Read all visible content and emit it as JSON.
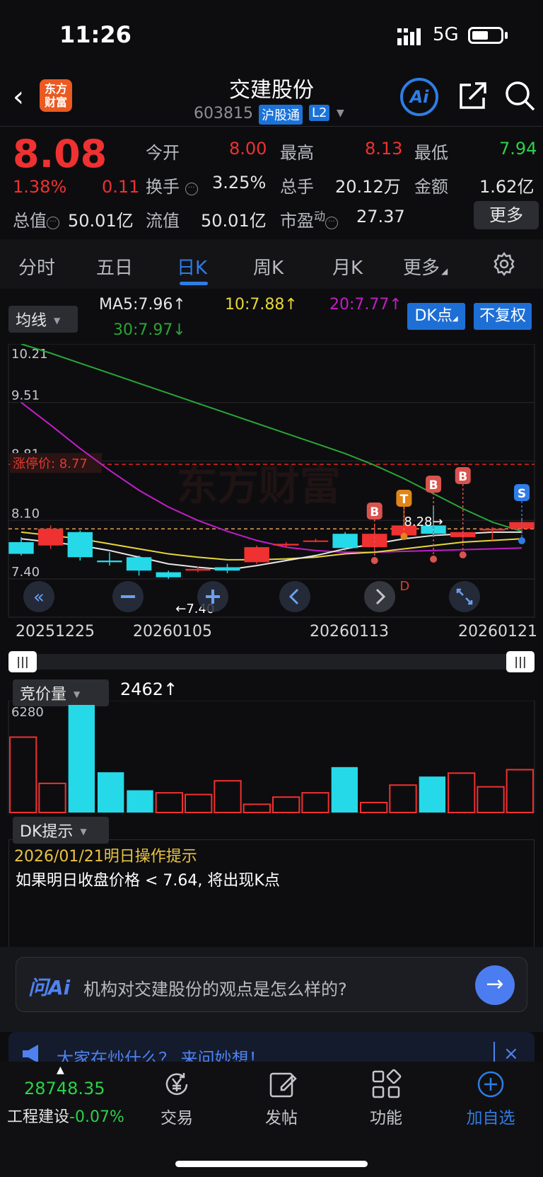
{
  "status": {
    "time": "11:26",
    "network": "5G"
  },
  "header": {
    "logo_line1": "东方",
    "logo_line2": "财富",
    "name": "交建股份",
    "code": "603815",
    "badge_hgt": "沪股通",
    "badge_l2": "L2",
    "ai_label": "Ai"
  },
  "quote": {
    "price": "8.08",
    "change_pct": "1.38%",
    "change_abs": "0.11",
    "open_label": "今开",
    "open": "8.00",
    "high_label": "最高",
    "high": "8.13",
    "low_label": "最低",
    "low": "7.94",
    "turnover_label": "换手",
    "turnover": "3.25%",
    "volume_label": "总手",
    "volume": "20.12万",
    "amount_label": "金额",
    "amount": "1.62亿",
    "mktcap_label": "总值",
    "mktcap": "50.01亿",
    "float_label": "流值",
    "float": "50.01亿",
    "pe_label": "市盈",
    "pe_sup": "动",
    "pe": "27.37",
    "more": "更多"
  },
  "tabs": [
    "分时",
    "五日",
    "日K",
    "周K",
    "月K",
    "更多"
  ],
  "active_tab": "日K",
  "indicator_bar": {
    "dropdown": "均线",
    "ma5": "MA5:7.96↑",
    "ma10": "10:7.88↑",
    "ma20": "20:7.77↑",
    "ma30": "30:7.97↓",
    "dk_button": "DK点",
    "fq_button": "不复权"
  },
  "colors": {
    "up": "#ef3131",
    "down": "#25d9e8",
    "ma5": "#e6e6e6",
    "ma10": "#e8d63a",
    "ma20": "#c21ec8",
    "ma30": "#2aa537",
    "accent": "#2f7de6"
  },
  "chart_data": {
    "type": "candlestick",
    "y_ticks": [
      "10.21",
      "9.51",
      "8.81",
      "8.10",
      "7.40"
    ],
    "ylim": [
      7.4,
      10.21
    ],
    "limit_up_label": "涨停价: 8.77",
    "limit_up": 8.77,
    "ref_line": 8.1,
    "watermark": "东方财富",
    "low_annotation": "←7.40",
    "high_annotation": "8.28→",
    "signals": [
      "B",
      "T",
      "B",
      "B",
      "S",
      "D"
    ],
    "x_labels": [
      "20251225",
      "20260105",
      "20260113",
      "20260121"
    ],
    "candles": [
      {
        "o": 7.84,
        "c": 7.7,
        "h": 7.9,
        "l": 7.68
      },
      {
        "o": 7.8,
        "c": 8.0,
        "h": 8.04,
        "l": 7.76
      },
      {
        "o": 7.96,
        "c": 7.66,
        "h": 7.98,
        "l": 7.62
      },
      {
        "o": 7.62,
        "c": 7.6,
        "h": 7.72,
        "l": 7.56
      },
      {
        "o": 7.66,
        "c": 7.5,
        "h": 7.68,
        "l": 7.44
      },
      {
        "o": 7.48,
        "c": 7.42,
        "h": 7.5,
        "l": 7.4
      },
      {
        "o": 7.5,
        "c": 7.52,
        "h": 7.55,
        "l": 7.48
      },
      {
        "o": 7.54,
        "c": 7.5,
        "h": 7.58,
        "l": 7.47
      },
      {
        "o": 7.6,
        "c": 7.78,
        "h": 7.8,
        "l": 7.58
      },
      {
        "o": 7.8,
        "c": 7.82,
        "h": 7.84,
        "l": 7.78
      },
      {
        "o": 7.86,
        "c": 7.86,
        "h": 7.88,
        "l": 7.84
      },
      {
        "o": 7.94,
        "c": 7.77,
        "h": 7.96,
        "l": 7.74
      },
      {
        "o": 7.78,
        "c": 7.94,
        "h": 8.04,
        "l": 7.76
      },
      {
        "o": 7.92,
        "c": 8.04,
        "h": 8.28,
        "l": 7.92
      },
      {
        "o": 8.04,
        "c": 7.94,
        "h": 8.28,
        "l": 7.92
      },
      {
        "o": 7.9,
        "c": 7.96,
        "h": 7.98,
        "l": 7.88
      },
      {
        "o": 7.98,
        "c": 8.0,
        "h": 8.02,
        "l": 7.86
      },
      {
        "o": 8.0,
        "c": 8.08,
        "h": 8.13,
        "l": 7.94
      }
    ],
    "ma5": [
      7.88,
      7.84,
      7.8,
      7.74,
      7.66,
      7.58,
      7.54,
      7.51,
      7.56,
      7.62,
      7.68,
      7.76,
      7.82,
      7.88,
      7.92,
      7.94,
      7.96,
      7.96
    ],
    "ma10": [
      7.96,
      7.92,
      7.88,
      7.82,
      7.76,
      7.7,
      7.66,
      7.63,
      7.63,
      7.64,
      7.66,
      7.7,
      7.72,
      7.76,
      7.8,
      7.84,
      7.86,
      7.88
    ],
    "ma20": [
      9.51,
      9.24,
      8.96,
      8.7,
      8.46,
      8.26,
      8.1,
      7.97,
      7.86,
      7.78,
      7.74,
      7.72,
      7.72,
      7.73,
      7.74,
      7.75,
      7.76,
      7.77
    ],
    "ma30": [
      10.21,
      10.1,
      9.98,
      9.86,
      9.74,
      9.62,
      9.5,
      9.38,
      9.26,
      9.14,
      9.02,
      8.9,
      8.76,
      8.6,
      8.42,
      8.24,
      8.08,
      7.97
    ]
  },
  "volume": {
    "dropdown": "竞价量",
    "value": "2462↑",
    "max_label": "6280",
    "max": 6280,
    "bars": [
      4400,
      1700,
      6280,
      2350,
      1300,
      1150,
      1050,
      1850,
      480,
      900,
      1150,
      2650,
      580,
      1600,
      2100,
      2300,
      1500,
      2500
    ],
    "dirs": [
      "u",
      "u",
      "d",
      "d",
      "d",
      "u",
      "u",
      "u",
      "u",
      "u",
      "u",
      "d",
      "u",
      "u",
      "d",
      "u",
      "u",
      "u"
    ]
  },
  "dk_tip": {
    "dropdown": "DK提示",
    "date": "2026/01/21明日操作提示",
    "text": "如果明日收盘价格 < 7.64, 将出现K点"
  },
  "ask": {
    "logo": "问Ai",
    "placeholder": "机构对交建股份的观点是怎么样的?",
    "go": "→"
  },
  "banner": {
    "text": "大家在炒什么？ 来问妙想！",
    "close": "×"
  },
  "bottom_nav": {
    "index_value": "28748.35",
    "index_name": "工程建设",
    "index_change": "-0.07%",
    "items": [
      "交易",
      "发帖",
      "功能",
      "加自选"
    ]
  }
}
